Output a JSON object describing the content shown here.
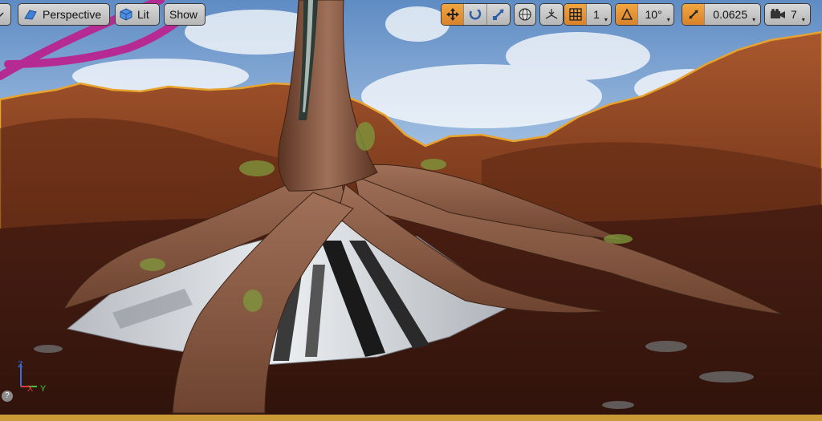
{
  "toolbar": {
    "perspective_label": "Perspective",
    "lit_label": "Lit",
    "show_label": "Show",
    "grid_snap_value": "1",
    "rotation_snap_value": "10°",
    "scale_snap_value": "0.0625",
    "camera_speed_value": "7"
  },
  "axis_gizmo": {
    "z_label": "Z",
    "y_label": "Y",
    "x_label": "X"
  },
  "help": {
    "label": "?"
  },
  "colors": {
    "accent": "#e0902f",
    "sky": "#6b95c8",
    "mountain": "#8e4a28",
    "ground": "#3e1a10",
    "tree": "#7a4a30",
    "spline": "#b0288f"
  }
}
